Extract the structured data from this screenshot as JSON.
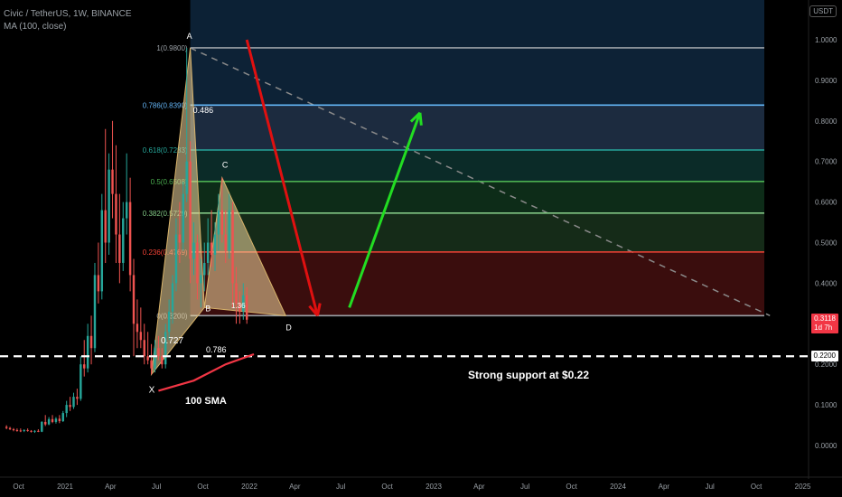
{
  "header": {
    "symbol_line": "Civic / TetherUS, 1W, BINANCE",
    "indicator_line": "MA (100, close)"
  },
  "currency_badge": "USDT",
  "colors": {
    "up": "#26a69a",
    "down": "#ef5350",
    "sma": "#f23645",
    "bearish_arrow": "#e01010",
    "bullish_arrow": "#22dd22",
    "pattern_fill": "#f3d9a0",
    "grid_text": "#9aa0a6"
  },
  "chart_data": {
    "type": "candlestick",
    "y_axis": {
      "ylim": [
        -0.05,
        1.1
      ],
      "ticks": [
        "1.0000",
        "0.9000",
        "0.8000",
        "0.7000",
        "0.6000",
        "0.5000",
        "0.4000",
        "0.3000",
        "0.2000",
        "0.1000",
        "0.0000"
      ]
    },
    "x_axis": {
      "ticks": [
        "Oct",
        "2021",
        "Apr",
        "Jul",
        "Oct",
        "2022",
        "Apr",
        "Jul",
        "Oct",
        "2023",
        "Apr",
        "Jul",
        "Oct",
        "2024",
        "Apr",
        "Jul",
        "Oct",
        "2025"
      ]
    },
    "price_badges": {
      "last_price": "0.3118",
      "countdown": "1d 7h",
      "support_price": "0.2200"
    },
    "fibonacci_levels": [
      {
        "label": "1(0.9800)",
        "ratio": 1,
        "price": 0.98,
        "color": "#9aa0a6",
        "zone": "#0d2236"
      },
      {
        "label": "0.786(0.8390)",
        "ratio": 0.786,
        "price": 0.839,
        "color": "#64b5f6",
        "zone": "#1c2b3f"
      },
      {
        "label": "0.618(0.7283)",
        "ratio": 0.618,
        "price": 0.7283,
        "color": "#26a69a",
        "zone": "#0b2b28"
      },
      {
        "label": "0.5(0.6508)",
        "ratio": 0.5,
        "price": 0.6508,
        "color": "#4caf50",
        "zone": "#0d2c18"
      },
      {
        "label": "0.382(0.5729)",
        "ratio": 0.382,
        "price": 0.5729,
        "color": "#81c784",
        "zone": "#152b18"
      },
      {
        "label": "0.236(0.4769)",
        "ratio": 0.236,
        "price": 0.4769,
        "color": "#f44336",
        "zone": "#3a0d0d"
      },
      {
        "label": "0(0.3200)",
        "ratio": 0,
        "price": 0.32,
        "color": "#9aa0a6",
        "zone": ""
      }
    ],
    "harmonic_pattern": {
      "points": [
        {
          "name": "X",
          "date": "2021-06-21",
          "price": 0.175
        },
        {
          "name": "A",
          "date": "2021-09-06",
          "price": 0.98
        },
        {
          "name": "B",
          "date": "2021-10-04",
          "price": 0.34
        },
        {
          "name": "C",
          "date": "2021-11-08",
          "price": 0.66
        },
        {
          "name": "D",
          "date": "2022-03-14",
          "price": 0.32
        }
      ],
      "ratio_labels": [
        "0.486",
        "0.727",
        "0.786",
        "1.36"
      ]
    },
    "trendline": {
      "from": {
        "date": "2021-09-06",
        "price": 0.98
      },
      "to": {
        "date": "2024-10-28",
        "price": 0.32
      }
    },
    "support": {
      "price": 0.22,
      "label": "Strong support at $0.22"
    },
    "sma_100": {
      "name": "100 SMA",
      "points": [
        {
          "date": "2021-07-05",
          "price": 0.135
        },
        {
          "date": "2021-09-13",
          "price": 0.16
        },
        {
          "date": "2021-11-15",
          "price": 0.2
        },
        {
          "date": "2022-01-10",
          "price": 0.225
        }
      ]
    },
    "projection_arrows": [
      {
        "direction": "down",
        "from": {
          "date": "2021-12-27",
          "price": 1.0
        },
        "to": {
          "date": "2022-05-16",
          "price": 0.32
        }
      },
      {
        "direction": "up",
        "from": {
          "date": "2022-07-18",
          "price": 0.34
        },
        "to": {
          "date": "2022-12-05",
          "price": 0.82
        }
      }
    ],
    "series_candles": [
      {
        "date": "2020-09-07",
        "o": 0.046,
        "h": 0.05,
        "l": 0.04,
        "c": 0.043
      },
      {
        "date": "2020-09-14",
        "o": 0.043,
        "h": 0.046,
        "l": 0.038,
        "c": 0.04
      },
      {
        "date": "2020-09-21",
        "o": 0.04,
        "h": 0.043,
        "l": 0.035,
        "c": 0.038
      },
      {
        "date": "2020-09-28",
        "o": 0.038,
        "h": 0.042,
        "l": 0.034,
        "c": 0.037
      },
      {
        "date": "2020-10-05",
        "o": 0.037,
        "h": 0.042,
        "l": 0.033,
        "c": 0.036
      },
      {
        "date": "2020-10-12",
        "o": 0.036,
        "h": 0.04,
        "l": 0.033,
        "c": 0.038
      },
      {
        "date": "2020-10-19",
        "o": 0.038,
        "h": 0.042,
        "l": 0.034,
        "c": 0.036
      },
      {
        "date": "2020-10-26",
        "o": 0.036,
        "h": 0.038,
        "l": 0.032,
        "c": 0.034
      },
      {
        "date": "2020-11-02",
        "o": 0.034,
        "h": 0.038,
        "l": 0.031,
        "c": 0.036
      },
      {
        "date": "2020-11-09",
        "o": 0.036,
        "h": 0.04,
        "l": 0.033,
        "c": 0.034
      },
      {
        "date": "2020-11-16",
        "o": 0.034,
        "h": 0.06,
        "l": 0.033,
        "c": 0.058
      },
      {
        "date": "2020-11-23",
        "o": 0.058,
        "h": 0.075,
        "l": 0.048,
        "c": 0.052
      },
      {
        "date": "2020-11-30",
        "o": 0.052,
        "h": 0.07,
        "l": 0.05,
        "c": 0.065
      },
      {
        "date": "2020-12-07",
        "o": 0.065,
        "h": 0.075,
        "l": 0.055,
        "c": 0.058
      },
      {
        "date": "2020-12-14",
        "o": 0.058,
        "h": 0.07,
        "l": 0.054,
        "c": 0.066
      },
      {
        "date": "2020-12-21",
        "o": 0.066,
        "h": 0.075,
        "l": 0.055,
        "c": 0.06
      },
      {
        "date": "2020-12-28",
        "o": 0.06,
        "h": 0.085,
        "l": 0.058,
        "c": 0.08
      },
      {
        "date": "2021-01-04",
        "o": 0.08,
        "h": 0.11,
        "l": 0.07,
        "c": 0.1
      },
      {
        "date": "2021-01-11",
        "o": 0.1,
        "h": 0.12,
        "l": 0.085,
        "c": 0.095
      },
      {
        "date": "2021-01-18",
        "o": 0.095,
        "h": 0.13,
        "l": 0.09,
        "c": 0.12
      },
      {
        "date": "2021-01-25",
        "o": 0.12,
        "h": 0.14,
        "l": 0.1,
        "c": 0.115
      },
      {
        "date": "2021-02-01",
        "o": 0.115,
        "h": 0.22,
        "l": 0.11,
        "c": 0.2
      },
      {
        "date": "2021-02-08",
        "o": 0.2,
        "h": 0.26,
        "l": 0.17,
        "c": 0.19
      },
      {
        "date": "2021-02-15",
        "o": 0.19,
        "h": 0.3,
        "l": 0.18,
        "c": 0.27
      },
      {
        "date": "2021-02-22",
        "o": 0.27,
        "h": 0.32,
        "l": 0.2,
        "c": 0.24
      },
      {
        "date": "2021-03-01",
        "o": 0.24,
        "h": 0.45,
        "l": 0.23,
        "c": 0.42
      },
      {
        "date": "2021-03-08",
        "o": 0.42,
        "h": 0.5,
        "l": 0.35,
        "c": 0.38
      },
      {
        "date": "2021-03-15",
        "o": 0.38,
        "h": 0.62,
        "l": 0.36,
        "c": 0.58
      },
      {
        "date": "2021-03-22",
        "o": 0.58,
        "h": 0.78,
        "l": 0.45,
        "c": 0.5
      },
      {
        "date": "2021-03-29",
        "o": 0.5,
        "h": 0.72,
        "l": 0.47,
        "c": 0.68
      },
      {
        "date": "2021-04-05",
        "o": 0.68,
        "h": 0.8,
        "l": 0.56,
        "c": 0.62
      },
      {
        "date": "2021-04-12",
        "o": 0.62,
        "h": 0.74,
        "l": 0.45,
        "c": 0.52
      },
      {
        "date": "2021-04-19",
        "o": 0.52,
        "h": 0.62,
        "l": 0.4,
        "c": 0.45
      },
      {
        "date": "2021-04-26",
        "o": 0.45,
        "h": 0.6,
        "l": 0.43,
        "c": 0.56
      },
      {
        "date": "2021-05-03",
        "o": 0.56,
        "h": 0.72,
        "l": 0.52,
        "c": 0.6
      },
      {
        "date": "2021-05-10",
        "o": 0.6,
        "h": 0.66,
        "l": 0.38,
        "c": 0.42
      },
      {
        "date": "2021-05-17",
        "o": 0.42,
        "h": 0.46,
        "l": 0.22,
        "c": 0.3
      },
      {
        "date": "2021-05-24",
        "o": 0.3,
        "h": 0.36,
        "l": 0.24,
        "c": 0.28
      },
      {
        "date": "2021-05-31",
        "o": 0.28,
        "h": 0.34,
        "l": 0.24,
        "c": 0.26
      },
      {
        "date": "2021-06-07",
        "o": 0.26,
        "h": 0.3,
        "l": 0.2,
        "c": 0.22
      },
      {
        "date": "2021-06-14",
        "o": 0.22,
        "h": 0.28,
        "l": 0.2,
        "c": 0.21
      },
      {
        "date": "2021-06-21",
        "o": 0.21,
        "h": 0.25,
        "l": 0.175,
        "c": 0.19
      },
      {
        "date": "2021-06-28",
        "o": 0.19,
        "h": 0.26,
        "l": 0.18,
        "c": 0.24
      },
      {
        "date": "2021-07-05",
        "o": 0.24,
        "h": 0.27,
        "l": 0.21,
        "c": 0.22
      },
      {
        "date": "2021-07-12",
        "o": 0.22,
        "h": 0.24,
        "l": 0.19,
        "c": 0.2
      },
      {
        "date": "2021-07-19",
        "o": 0.2,
        "h": 0.3,
        "l": 0.19,
        "c": 0.28
      },
      {
        "date": "2021-07-26",
        "o": 0.28,
        "h": 0.36,
        "l": 0.26,
        "c": 0.33
      },
      {
        "date": "2021-08-02",
        "o": 0.33,
        "h": 0.42,
        "l": 0.3,
        "c": 0.4
      },
      {
        "date": "2021-08-09",
        "o": 0.4,
        "h": 0.56,
        "l": 0.38,
        "c": 0.52
      },
      {
        "date": "2021-08-16",
        "o": 0.52,
        "h": 0.6,
        "l": 0.45,
        "c": 0.5
      },
      {
        "date": "2021-08-23",
        "o": 0.5,
        "h": 0.65,
        "l": 0.48,
        "c": 0.62
      },
      {
        "date": "2021-08-30",
        "o": 0.62,
        "h": 0.98,
        "l": 0.6,
        "c": 0.7
      },
      {
        "date": "2021-09-06",
        "o": 0.7,
        "h": 0.75,
        "l": 0.4,
        "c": 0.46
      },
      {
        "date": "2021-09-13",
        "o": 0.46,
        "h": 0.55,
        "l": 0.42,
        "c": 0.5
      },
      {
        "date": "2021-09-20",
        "o": 0.5,
        "h": 0.52,
        "l": 0.36,
        "c": 0.4
      },
      {
        "date": "2021-09-27",
        "o": 0.4,
        "h": 0.46,
        "l": 0.34,
        "c": 0.42
      },
      {
        "date": "2021-10-04",
        "o": 0.42,
        "h": 0.5,
        "l": 0.38,
        "c": 0.45
      },
      {
        "date": "2021-10-11",
        "o": 0.45,
        "h": 0.56,
        "l": 0.42,
        "c": 0.5
      },
      {
        "date": "2021-10-18",
        "o": 0.5,
        "h": 0.58,
        "l": 0.44,
        "c": 0.47
      },
      {
        "date": "2021-10-25",
        "o": 0.47,
        "h": 0.55,
        "l": 0.43,
        "c": 0.52
      },
      {
        "date": "2021-11-01",
        "o": 0.52,
        "h": 0.62,
        "l": 0.48,
        "c": 0.58
      },
      {
        "date": "2021-11-08",
        "o": 0.58,
        "h": 0.66,
        "l": 0.5,
        "c": 0.52
      },
      {
        "date": "2021-11-15",
        "o": 0.52,
        "h": 0.58,
        "l": 0.45,
        "c": 0.48
      },
      {
        "date": "2021-11-22",
        "o": 0.48,
        "h": 0.62,
        "l": 0.46,
        "c": 0.58
      },
      {
        "date": "2021-11-29",
        "o": 0.58,
        "h": 0.6,
        "l": 0.34,
        "c": 0.4
      },
      {
        "date": "2021-12-06",
        "o": 0.4,
        "h": 0.44,
        "l": 0.3,
        "c": 0.35
      },
      {
        "date": "2021-12-13",
        "o": 0.35,
        "h": 0.38,
        "l": 0.3,
        "c": 0.33
      },
      {
        "date": "2021-12-20",
        "o": 0.33,
        "h": 0.4,
        "l": 0.31,
        "c": 0.37
      },
      {
        "date": "2021-12-27",
        "o": 0.37,
        "h": 0.39,
        "l": 0.3,
        "c": 0.31
      }
    ]
  },
  "annotations": {
    "point_x": "X",
    "point_a": "A",
    "point_b": "B",
    "point_c": "C",
    "point_d": "D",
    "ratio_ab": "0.486",
    "ratio_xb": "0.727",
    "ratio_xd": "0.786",
    "ratio_bd": "1.36",
    "sma_label": "100 SMA",
    "support_label": "Strong support at $0.22"
  }
}
